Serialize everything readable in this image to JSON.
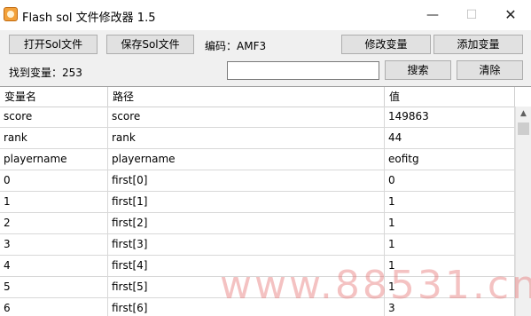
{
  "window": {
    "title": "Flash sol 文件修改器 1.5",
    "minimize_glyph": "—",
    "maximize_glyph": "☐",
    "close_glyph": "✕"
  },
  "toolbar": {
    "open_label": "打开Sol文件",
    "save_label": "保存Sol文件",
    "encoding_label": "编码：AMF3",
    "modify_label": "修改变量",
    "add_label": "添加变量"
  },
  "search": {
    "found_label": "找到变量：253",
    "input_value": "",
    "search_button": "搜索",
    "clear_button": "清除"
  },
  "table": {
    "columns": [
      "变量名",
      "路径",
      "值"
    ],
    "rows": [
      [
        "score",
        "score",
        "149863"
      ],
      [
        "rank",
        "rank",
        "44"
      ],
      [
        "playername",
        "playername",
        "eofitg"
      ],
      [
        "0",
        "first[0]",
        "0"
      ],
      [
        "1",
        "first[1]",
        "1"
      ],
      [
        "2",
        "first[2]",
        "1"
      ],
      [
        "3",
        "first[3]",
        "1"
      ],
      [
        "4",
        "first[4]",
        "1"
      ],
      [
        "5",
        "first[5]",
        "1"
      ],
      [
        "6",
        "first[6]",
        "3"
      ]
    ]
  },
  "watermark": "www.88531.cn",
  "colors": {
    "button_bg": "#e1e1e1",
    "border": "#adadad",
    "watermark": "#e67878"
  }
}
